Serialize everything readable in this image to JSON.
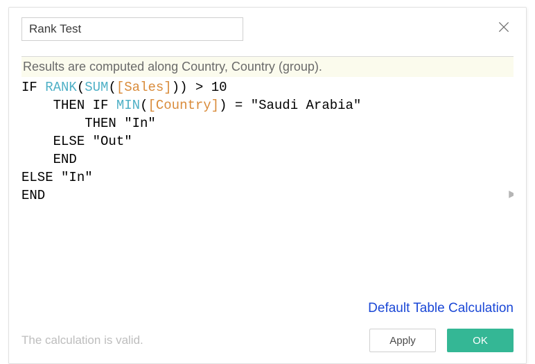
{
  "header": {
    "field_name": "Rank Test"
  },
  "results_banner": "Results are computed along Country, Country (group).",
  "formula": {
    "tokens": [
      {
        "t": "kw",
        "v": "IF"
      },
      {
        "t": "txt",
        "v": " "
      },
      {
        "t": "func",
        "v": "RANK"
      },
      {
        "t": "txt",
        "v": "("
      },
      {
        "t": "func",
        "v": "SUM"
      },
      {
        "t": "txt",
        "v": "("
      },
      {
        "t": "fld",
        "v": "[Sales]"
      },
      {
        "t": "txt",
        "v": ")) > 10"
      },
      {
        "t": "nl"
      },
      {
        "t": "txt",
        "v": "    "
      },
      {
        "t": "kw",
        "v": "THEN"
      },
      {
        "t": "txt",
        "v": " "
      },
      {
        "t": "kw",
        "v": "IF"
      },
      {
        "t": "txt",
        "v": " "
      },
      {
        "t": "func",
        "v": "MIN"
      },
      {
        "t": "txt",
        "v": "("
      },
      {
        "t": "fld",
        "v": "[Country]"
      },
      {
        "t": "txt",
        "v": ") = \"Saudi Arabia\""
      },
      {
        "t": "nl"
      },
      {
        "t": "txt",
        "v": "        "
      },
      {
        "t": "kw",
        "v": "THEN"
      },
      {
        "t": "txt",
        "v": " \"In\""
      },
      {
        "t": "nl"
      },
      {
        "t": "txt",
        "v": "    "
      },
      {
        "t": "kw",
        "v": "ELSE"
      },
      {
        "t": "txt",
        "v": " \"Out\""
      },
      {
        "t": "nl"
      },
      {
        "t": "txt",
        "v": "    "
      },
      {
        "t": "kw",
        "v": "END"
      },
      {
        "t": "nl"
      },
      {
        "t": "kw",
        "v": "ELSE"
      },
      {
        "t": "txt",
        "v": " \"In\""
      },
      {
        "t": "nl"
      },
      {
        "t": "kw",
        "v": "END"
      }
    ]
  },
  "link": {
    "default_table_calc": "Default Table Calculation"
  },
  "footer": {
    "status": "The calculation is valid.",
    "apply_label": "Apply",
    "ok_label": "OK"
  }
}
